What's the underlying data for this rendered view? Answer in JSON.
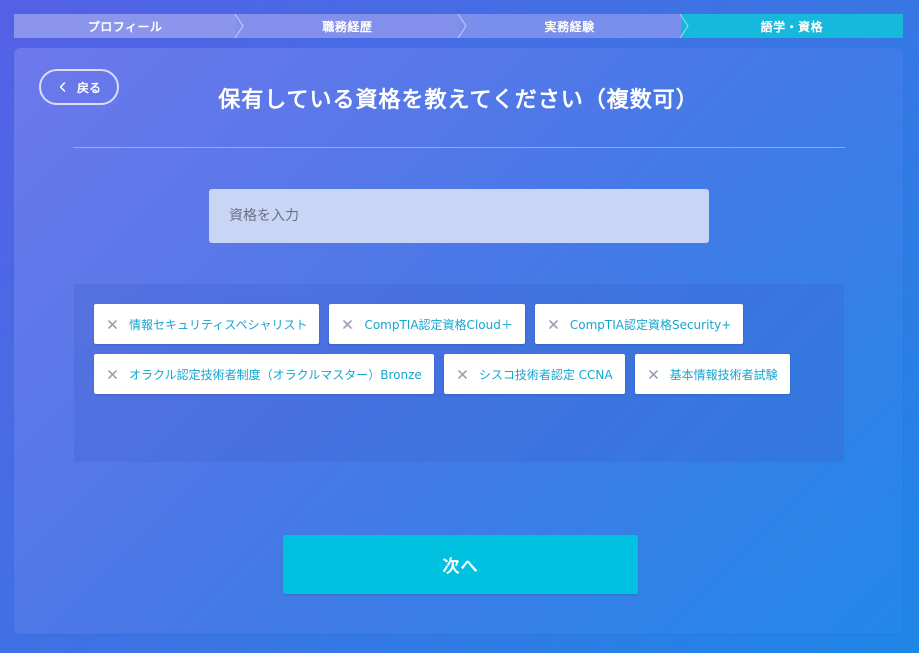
{
  "stepper": {
    "steps": [
      {
        "label": "プロフィール"
      },
      {
        "label": "職務経歴"
      },
      {
        "label": "実務経験"
      },
      {
        "label": "語学・資格"
      }
    ],
    "active_index": 3
  },
  "back": {
    "label": "戻る",
    "icon": "chevron-left-icon"
  },
  "title": "保有している資格を教えてください（複数可）",
  "search": {
    "placeholder": "資格を入力",
    "value": ""
  },
  "tags": [
    {
      "label": "情報セキュリティスペシャリスト"
    },
    {
      "label": "CompTIA認定資格Cloud＋"
    },
    {
      "label": "CompTIA認定資格Security+"
    },
    {
      "label": "オラクル認定技術者制度（オラクルマスター）Bronze"
    },
    {
      "label": "シスコ技術者認定 CCNA"
    },
    {
      "label": "基本情報技術者試験"
    }
  ],
  "next": {
    "label": "次へ"
  },
  "colors": {
    "accent": "#00c2e0",
    "tag_text": "#14a6d0",
    "active_step": "#16b8dc"
  }
}
